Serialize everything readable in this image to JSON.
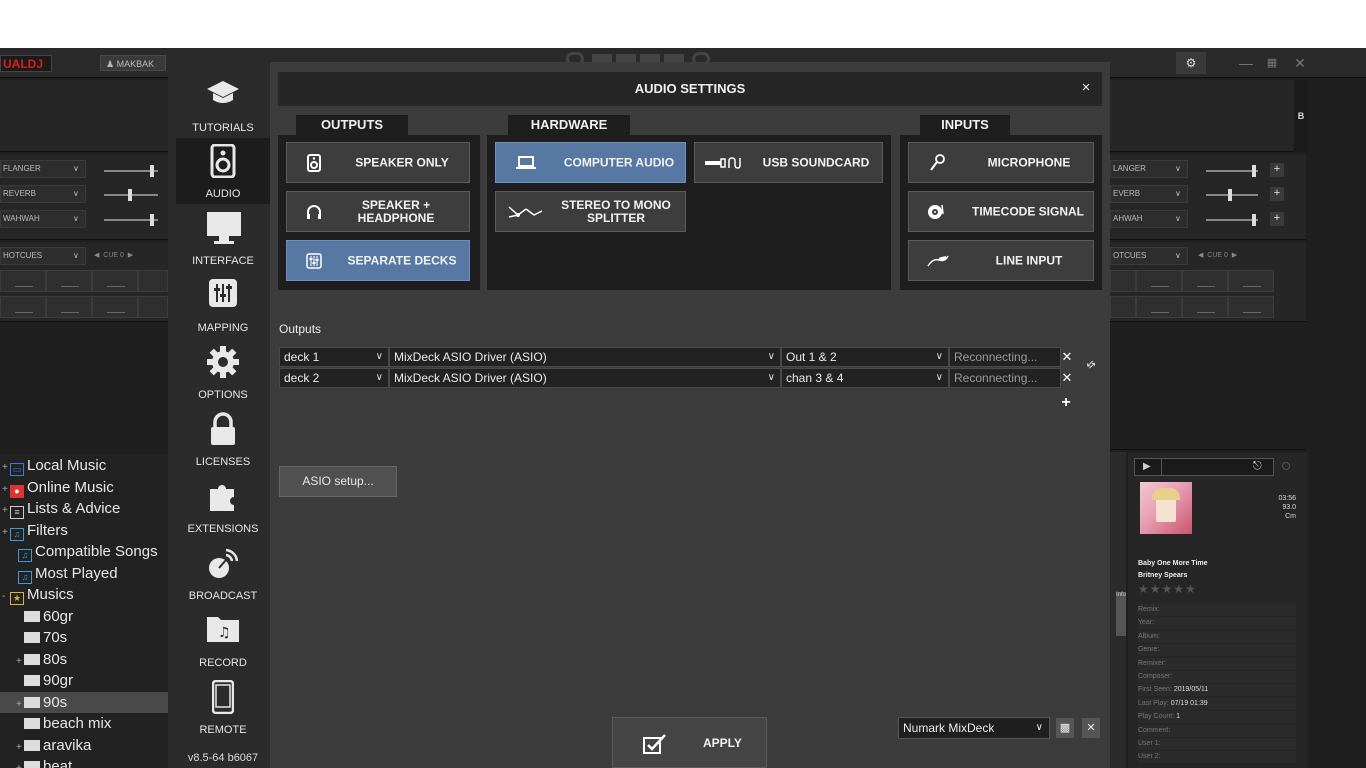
{
  "app": {
    "logo_text": "UALDJ",
    "user": "MAKBAK",
    "fx_left": [
      "FLANGER",
      "REVERB",
      "WAHWAH"
    ],
    "fx_right": [
      "LANGER",
      "EVERB",
      "AHWAH"
    ],
    "hotcues_left": "HOTCUES",
    "hotcues_right": "OTCUES",
    "cue_left": "CUE 0",
    "cue_right": "CUE 0"
  },
  "browser": {
    "items": [
      {
        "label": "Local Music",
        "expander": "+",
        "icon": "computer-icon",
        "indent": 0
      },
      {
        "label": "Online Music",
        "expander": "+",
        "icon": "online-music-icon",
        "indent": 0
      },
      {
        "label": "Lists & Advice",
        "expander": "+",
        "icon": "list-icon",
        "indent": 0
      },
      {
        "label": "Filters",
        "expander": "+",
        "icon": "filter-folder-icon",
        "indent": 0
      },
      {
        "label": "Compatible Songs",
        "expander": "",
        "icon": "filter-folder-icon",
        "indent": 1
      },
      {
        "label": "Most Played",
        "expander": "",
        "icon": "filter-folder-icon",
        "indent": 1
      },
      {
        "label": "Musics",
        "expander": "-",
        "icon": "star-folder-icon",
        "indent": 0
      },
      {
        "label": "60gr",
        "expander": "",
        "icon": "folder-icon",
        "indent": 2
      },
      {
        "label": "70s",
        "expander": "",
        "icon": "folder-icon",
        "indent": 2
      },
      {
        "label": "80s",
        "expander": "+",
        "icon": "folder-icon",
        "indent": 2
      },
      {
        "label": "90gr",
        "expander": "",
        "icon": "folder-icon",
        "indent": 2
      },
      {
        "label": "90s",
        "expander": "+",
        "icon": "folder-icon",
        "indent": 2,
        "selected": true
      },
      {
        "label": "beach mix",
        "expander": "",
        "icon": "folder-icon",
        "indent": 2
      },
      {
        "label": "aravika",
        "expander": "+",
        "icon": "folder-icon",
        "indent": 2
      },
      {
        "label": "beat",
        "expander": "+",
        "icon": "folder-icon",
        "indent": 2
      }
    ]
  },
  "info_panel": {
    "time": "03:56",
    "bpm": "93.0",
    "key": "Cm",
    "title": "Baby One More Time",
    "artist": "Britney Spears",
    "fields": [
      {
        "label": "Remix:",
        "value": ""
      },
      {
        "label": "Year:",
        "value": ""
      },
      {
        "label": "Album:",
        "value": ""
      },
      {
        "label": "Genre:",
        "value": ""
      },
      {
        "label": "Remixer:",
        "value": ""
      },
      {
        "label": "Composer:",
        "value": ""
      },
      {
        "label": "First Seen:",
        "value": "2019/05/11"
      },
      {
        "label": "Last Play:",
        "value": "07/19 01:39"
      },
      {
        "label": "Play Count:",
        "value": "1"
      },
      {
        "label": "Comment:",
        "value": ""
      },
      {
        "label": "User 1:",
        "value": ""
      },
      {
        "label": "User 2:",
        "value": ""
      }
    ]
  },
  "sidebar": {
    "items": [
      {
        "label": "TUTORIALS",
        "icon": "graduation-cap-icon"
      },
      {
        "label": "AUDIO",
        "icon": "speaker-icon",
        "active": true
      },
      {
        "label": "INTERFACE",
        "icon": "monitor-icon"
      },
      {
        "label": "MAPPING",
        "icon": "sliders-icon"
      },
      {
        "label": "OPTIONS",
        "icon": "gear-icon"
      },
      {
        "label": "LICENSES",
        "icon": "lock-icon"
      },
      {
        "label": "EXTENSIONS",
        "icon": "puzzle-icon"
      },
      {
        "label": "BROADCAST",
        "icon": "broadcast-icon"
      },
      {
        "label": "RECORD",
        "icon": "record-folder-icon"
      },
      {
        "label": "REMOTE",
        "icon": "phone-icon"
      }
    ],
    "version": "v8.5-64 b6067"
  },
  "dialog": {
    "title": "AUDIO SETTINGS",
    "close": "×",
    "sections": {
      "outputs": "OUTPUTS",
      "hardware": "HARDWARE",
      "inputs": "INPUTS"
    },
    "outputs_buttons": [
      {
        "label": "SPEAKER ONLY",
        "icon": "speaker-icon"
      },
      {
        "label": "SPEAKER + HEADPHONE",
        "icon": "headphone-icon"
      },
      {
        "label": "SEPARATE DECKS",
        "icon": "mixer-icon",
        "active": true
      }
    ],
    "hardware_buttons": [
      {
        "label": "COMPUTER AUDIO",
        "icon": "laptop-icon",
        "active": true
      },
      {
        "label": "USB SOUNDCARD",
        "icon": "usb-icon"
      },
      {
        "label": "STEREO TO MONO SPLITTER",
        "icon": "splitter-icon"
      }
    ],
    "inputs_buttons": [
      {
        "label": "MICROPHONE",
        "icon": "microphone-icon"
      },
      {
        "label": "TIMECODE SIGNAL",
        "icon": "turntable-icon"
      },
      {
        "label": "LINE INPUT",
        "icon": "line-input-icon"
      }
    ],
    "outputs_label": "Outputs",
    "outputs_rows": [
      {
        "deck": "deck 1",
        "driver": "MixDeck ASIO Driver (ASIO)",
        "channel": "Out 1 & 2",
        "status": "Reconnecting..."
      },
      {
        "deck": "deck 2",
        "driver": "MixDeck ASIO Driver (ASIO)",
        "channel": "chan 3 & 4",
        "status": "Reconnecting..."
      }
    ],
    "asio_button": "ASIO setup...",
    "apply_button": "APPLY",
    "preset": "Numark MixDeck"
  }
}
